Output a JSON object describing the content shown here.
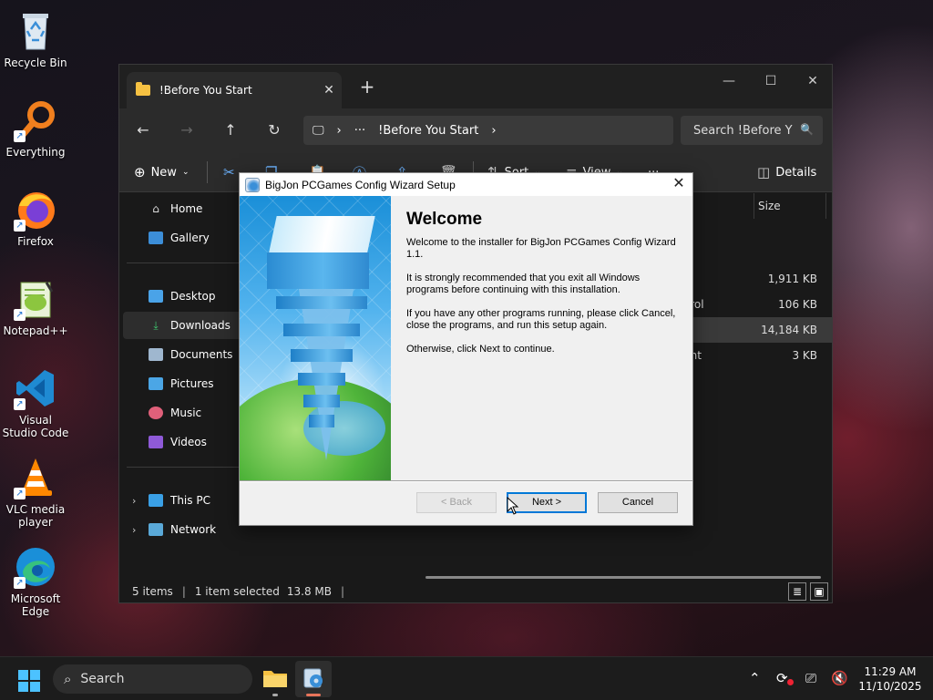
{
  "desktop": {
    "icons": [
      {
        "label": "Recycle Bin"
      },
      {
        "label": "Everything"
      },
      {
        "label": "Firefox"
      },
      {
        "label": "Notepad++"
      },
      {
        "label": "Visual Studio Code"
      },
      {
        "label": "VLC media player"
      },
      {
        "label": "Microsoft Edge"
      }
    ]
  },
  "explorer": {
    "tab_title": "!Before You Start",
    "tab_close": "✕",
    "tab_add": "+",
    "window_controls": {
      "minimize": "—",
      "maximize": "☐",
      "close": "✕"
    },
    "address": {
      "pc_icon": "monitor-icon",
      "chevron1": "›",
      "more": "···",
      "folder": "!Before You Start",
      "chevron2": "›"
    },
    "search_placeholder": "Search !Before Y",
    "toolbar": {
      "new": "New",
      "sort": "Sort",
      "view": "View",
      "more": "···",
      "details": "Details"
    },
    "sidebar": {
      "home": "Home",
      "gallery": "Gallery",
      "desktop": "Desktop",
      "downloads": "Downloads",
      "documents": "Documents",
      "pictures": "Pictures",
      "music": "Music",
      "videos": "Videos",
      "this_pc": "This PC",
      "network": "Network"
    },
    "column_size": "Size",
    "rows": [
      {
        "type": "r",
        "size": ""
      },
      {
        "type": "on",
        "size": "1,911 KB"
      },
      {
        "type": "control",
        "size": "106 KB"
      },
      {
        "type": "on",
        "size": "14,184 KB"
      },
      {
        "type": "ument",
        "size": "3 KB"
      }
    ],
    "status": {
      "items": "5 items",
      "selected": "1 item selected",
      "size": "13.8 MB"
    }
  },
  "wizard": {
    "title": "BigJon PCGames Config Wizard Setup",
    "close": "✕",
    "heading": "Welcome",
    "p1": "Welcome to the installer for BigJon PCGames Config Wizard 1.1.",
    "p2": "It is strongly recommended that you exit all Windows programs before continuing with this installation.",
    "p3": "If you have any other programs running, please click Cancel, close the programs, and run this setup again.",
    "p4": "Otherwise, click Next to continue.",
    "back_label": "< Back",
    "next_label": "Next >",
    "cancel_label": "Cancel"
  },
  "taskbar": {
    "search_label": "Search",
    "time": "11:29 AM",
    "date": "11/10/2025"
  }
}
